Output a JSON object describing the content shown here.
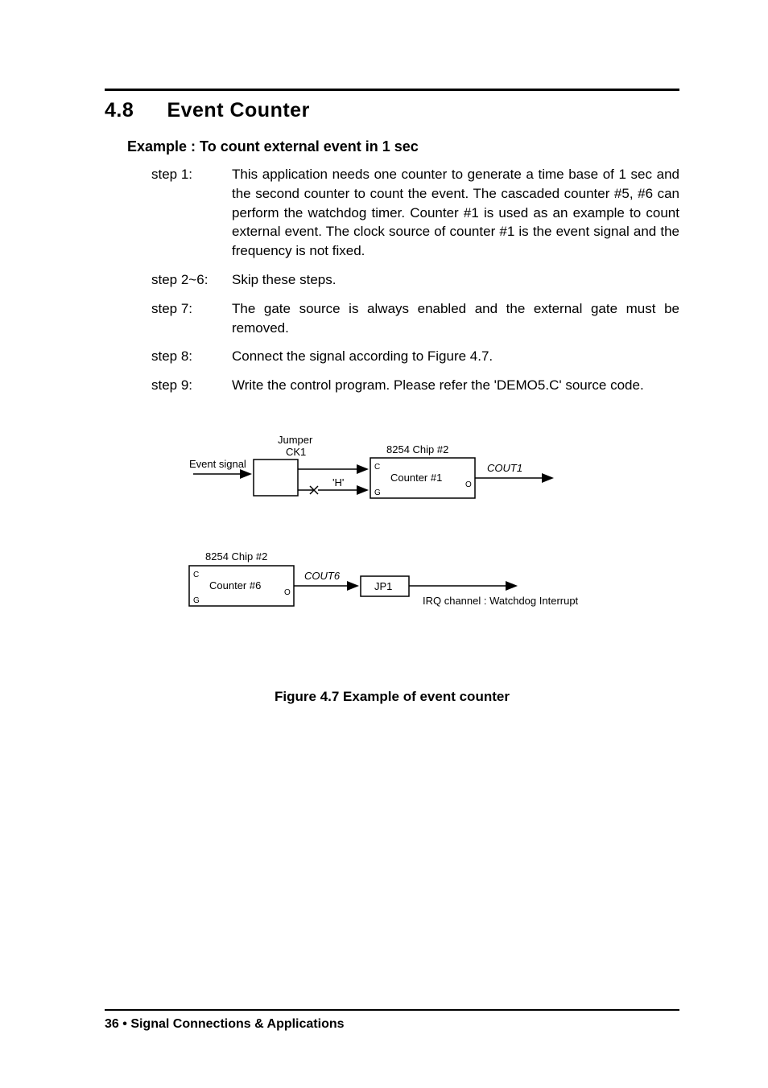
{
  "section": {
    "number": "4.8",
    "title": "Event Counter"
  },
  "example": {
    "title": "Example : To count external event in 1 sec"
  },
  "steps": {
    "s1": {
      "label": "step 1:",
      "body": "This application needs one counter to generate a time base of 1 sec and the second counter to count the event. The cascaded counter #5, #6 can perform the watchdog timer. Counter #1 is used as an example to count external event. The clock source of counter #1 is the event signal and the frequency is not fixed."
    },
    "s2": {
      "label": "step 2~6:",
      "body": "Skip these steps."
    },
    "s7": {
      "label": "step 7:",
      "body": "The gate source is always enabled and the external gate must be removed."
    },
    "s8": {
      "label": "step 8:",
      "body": "Connect the signal according to Figure 4.7."
    },
    "s9": {
      "label": "step 9:",
      "body": "Write the control program. Please refer the 'DEMO5.C' source code."
    }
  },
  "diagram": {
    "event_signal": "Event signal",
    "jumper": "Jumper",
    "ck1": "CK1",
    "h": "'H'",
    "chip2_top": "8254 Chip #2",
    "counter1": "Counter #1",
    "cout1": "COUT1",
    "chip2_bot": "8254 Chip #2",
    "counter6": "Counter #6",
    "cout6": "COUT6",
    "jp1": "JP1",
    "irq": "IRQ channel : Watchdog Interrupt",
    "c": "C",
    "g": "G",
    "o": "O"
  },
  "figure_caption": "Figure 4.7 Example of event counter",
  "footer": {
    "page": "36",
    "bullet": "•",
    "text": "Signal Connections & Applications"
  }
}
